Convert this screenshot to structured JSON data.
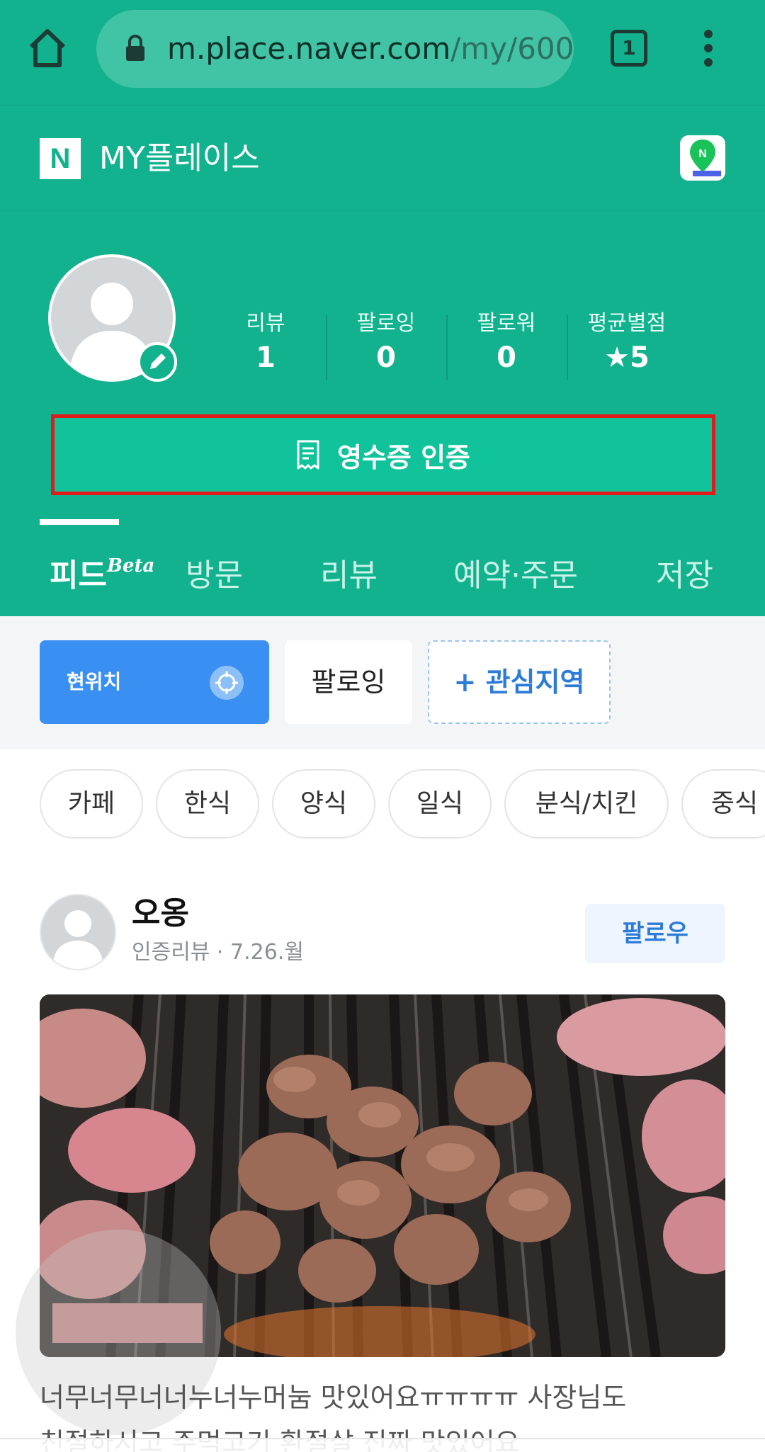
{
  "browser": {
    "url_domain": "m.place.naver.com",
    "url_path": "/my/600",
    "tab_count": "1"
  },
  "header": {
    "logo_letter": "N",
    "title": "MY플레이스"
  },
  "profile": {
    "stats": [
      {
        "label": "리뷰",
        "value": "1"
      },
      {
        "label": "팔로잉",
        "value": "0"
      },
      {
        "label": "팔로워",
        "value": "0"
      },
      {
        "label": "평균별점",
        "value": "★5"
      }
    ],
    "receipt_button_label": "영수증 인증"
  },
  "tabs": {
    "feed": "피드",
    "feed_badge": "Beta",
    "visit": "방문",
    "review": "리뷰",
    "reservation": "예약·주문",
    "saved": "저장"
  },
  "filters": {
    "location": "현위치",
    "following": "팔로잉",
    "add_region": "+ 관심지역"
  },
  "categories": [
    "카페",
    "한식",
    "양식",
    "일식",
    "분식/치킨",
    "중식"
  ],
  "post": {
    "user_name": "오옹",
    "meta": "인증리뷰 · 7.26.월",
    "follow_label": "팔로우",
    "text_line1": "너무너무너너누너누머눔 맛있어요ㅠㅠㅠㅠ 사장님도",
    "text_line2": "친절하시고 주먹고기 환절살 진짜 맛있어요"
  },
  "colors": {
    "brand_green": "#12b28e",
    "highlight_red": "#e01b1b",
    "location_blue": "#3a8ff2"
  }
}
